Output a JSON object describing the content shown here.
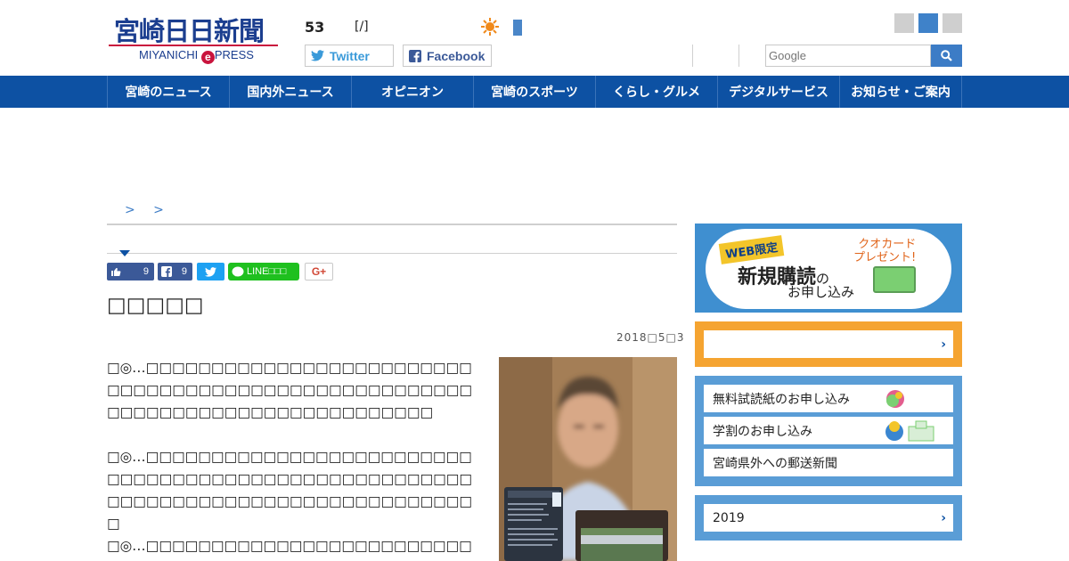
{
  "header": {
    "logo_main": "宮崎日日新聞",
    "logo_sub_prefix": "MIYANICHI",
    "logo_sub_e": "e",
    "logo_sub_suffix": "PRESS",
    "issue_number": "53",
    "issue_date": "[/]",
    "twitter_label": "Twitter",
    "facebook_label": "Facebook",
    "search_placeholder": "Google",
    "accent_color": "#0d51a3"
  },
  "nav": {
    "items": [
      {
        "label": "宮崎のニュース"
      },
      {
        "label": "国内外ニュース"
      },
      {
        "label": "オピニオン"
      },
      {
        "label": "宮崎のスポーツ"
      },
      {
        "label": "くらし・グルメ"
      },
      {
        "label": "デジタルサービス"
      },
      {
        "label": "お知らせ・ご案内"
      }
    ]
  },
  "breadcrumb": "> >",
  "share": {
    "like_count": "9",
    "fb_count": "9",
    "line_label": "LINE□□□",
    "gplus_label": "G+"
  },
  "article": {
    "title": "□□□□□",
    "date": "2018□5□3",
    "paragraphs": [
      "□◎…□□□□□□□□□□□□□□□□□□□□□□□□□□□□□□□□□□□□□□□□□□□□□□□□□□□□□□□□□□□□□□□□□□□□□□□□□□□□□□",
      "□◎…□□□□□□□□□□□□□□□□□□□□□□□□□□□□□□□□□□□□□□□□□□□□□□□□□□□□□□□□□□□□□□□□□□□□□□□□□□□□□□□□□□",
      "□◎…□□□□□□□□□□□□□□□□□□□□□□□□□"
    ]
  },
  "sidebar": {
    "banner_badge": "WEB限定",
    "banner_main": "新規購読",
    "banner_no": "の",
    "banner_sub": "お申し込み",
    "banner_present": "クオカード\nプレゼント!",
    "links": [
      {
        "label": "無料試読紙のお申し込み"
      },
      {
        "label": "学割のお申し込み"
      },
      {
        "label": "宮崎県外への郵送新聞"
      }
    ],
    "year_label": "2019"
  }
}
